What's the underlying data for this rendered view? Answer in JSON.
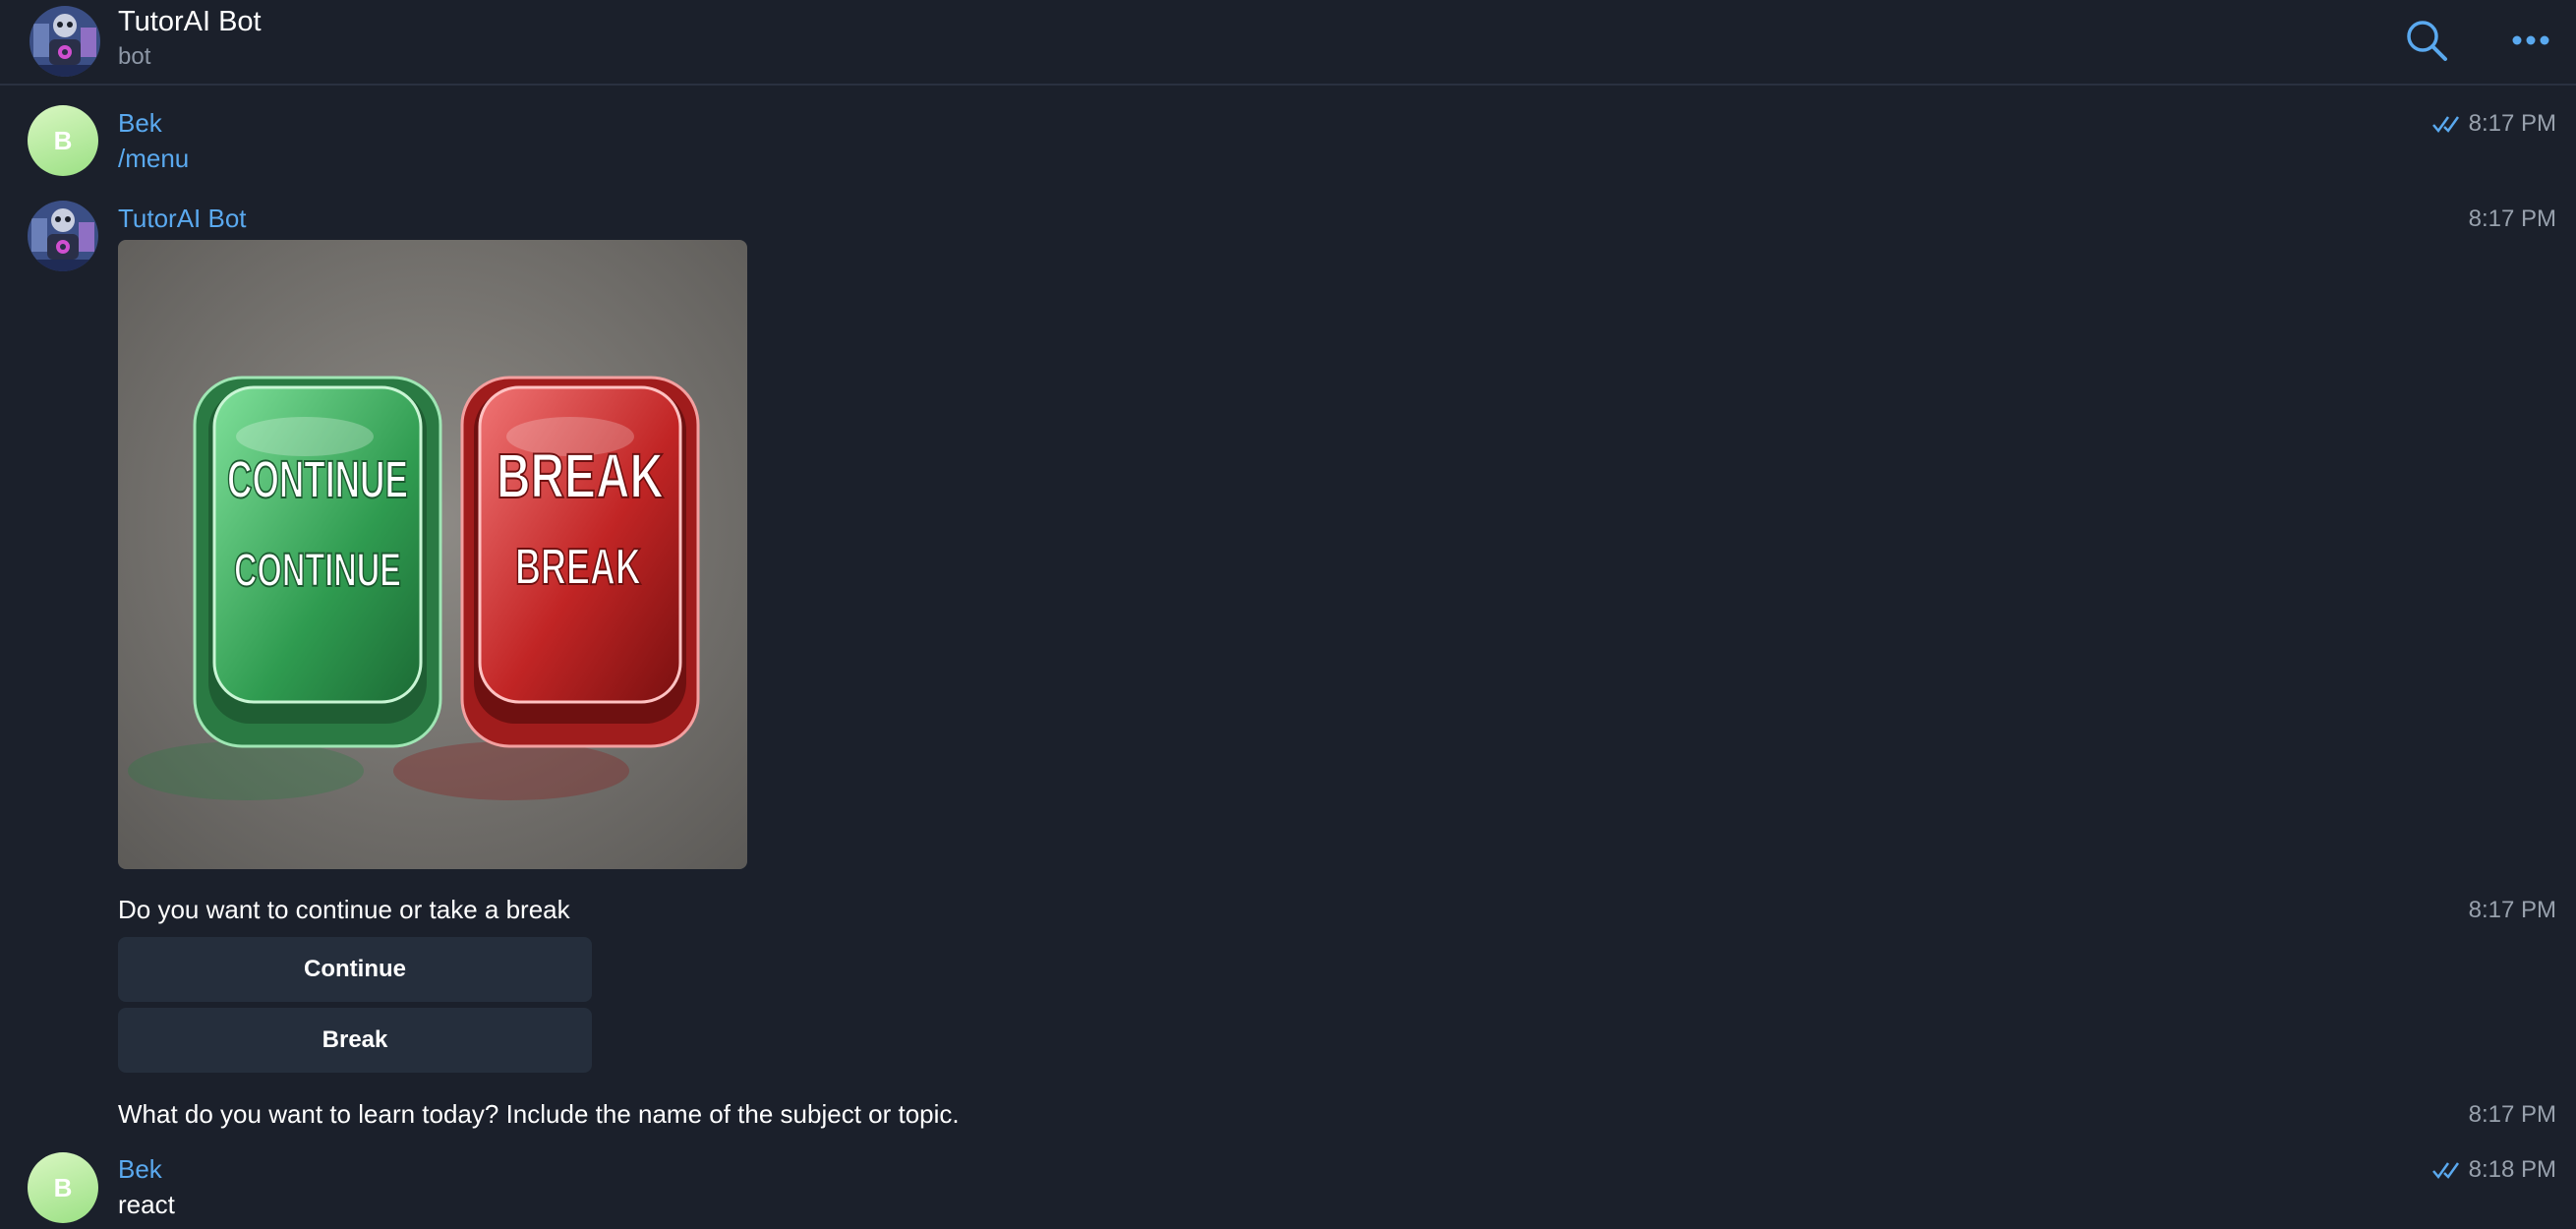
{
  "header": {
    "title": "TutorAI Bot",
    "subtitle": "bot"
  },
  "messages": [
    {
      "sender": "Bek",
      "avatar_letter": "B",
      "text": "/menu",
      "time": "8:17 PM",
      "read": true
    },
    {
      "sender": "TutorAI Bot",
      "image_button_labels": [
        "CONTINUE",
        "CONTINUE",
        "BREAK",
        "BREAK"
      ],
      "time": "8:17 PM"
    },
    {
      "text": "Do you want to continue or take a break",
      "time": "8:17 PM",
      "buttons": [
        "Continue",
        "Break"
      ]
    },
    {
      "text": "What do you want to learn today? Include the name of the subject or topic.",
      "time": "8:17 PM"
    },
    {
      "sender": "Bek",
      "avatar_letter": "B",
      "text": "react",
      "time": "8:18 PM",
      "read": true
    }
  ],
  "icons": {
    "search": "search-icon",
    "more": "more-icon",
    "read": "double-check-icon"
  },
  "colors": {
    "background": "#1b202b",
    "accent": "#5aa9ef",
    "button_bg": "#252e3c",
    "time": "#98a1ad"
  }
}
